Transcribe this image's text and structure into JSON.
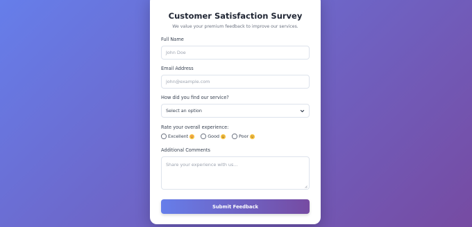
{
  "survey": {
    "title": "Customer Satisfaction Survey",
    "subtitle": "We value your premium feedback to improve our services."
  },
  "fields": {
    "full_name": {
      "label": "Full Name",
      "placeholder": "John Doe"
    },
    "email": {
      "label": "Email Address",
      "placeholder": "john@example.com"
    },
    "source": {
      "label": "How did you find our service?",
      "selected": "Select an option"
    },
    "rating": {
      "label": "Rate your overall experience:",
      "options": [
        {
          "label": "Excellent",
          "icon": "heart-eyes-emoji-icon"
        },
        {
          "label": "Good",
          "icon": "smile-emoji-icon"
        },
        {
          "label": "Poor",
          "icon": "neutral-emoji-icon"
        }
      ]
    },
    "comments": {
      "label": "Additional Comments",
      "placeholder": "Share your experience with us..."
    }
  },
  "submit": {
    "label": "Submit Feedback"
  },
  "colors": {
    "gradient_start": "#667eea",
    "gradient_end": "#764ba2"
  }
}
